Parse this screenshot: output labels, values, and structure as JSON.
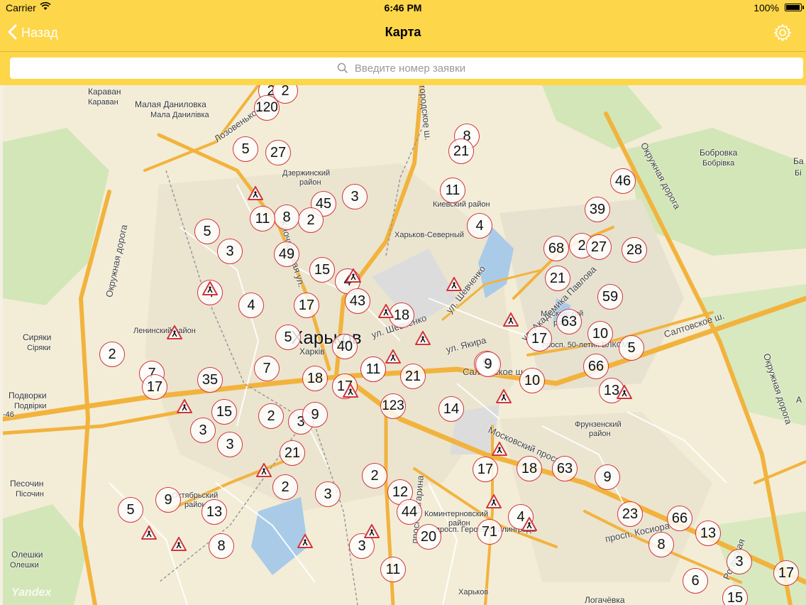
{
  "status_bar": {
    "carrier": "Carrier",
    "time": "6:46 PM",
    "battery": "100%",
    "battery_level": 1.0
  },
  "nav": {
    "back_label": "Назад",
    "title": "Карта"
  },
  "search": {
    "placeholder": "Введите номер заявки",
    "value": ""
  },
  "colors": {
    "bar": "#fdd64a",
    "marker_border": "#d2353c",
    "road": "#f2b33d",
    "park": "#cfe3b3"
  },
  "map": {
    "provider_watermark": "Yandex",
    "labels": {
      "karavan": "Караван",
      "karavan_ua": "Караван",
      "mala_danylivka": "Малая Даниловка",
      "mala_danylivka_ua": "Мала Данилівка",
      "bobrovka": "Бобровка",
      "bobrovka_ua": "Бобрівка",
      "dzerzhinsky": "Дзержинский",
      "dzerzhinsky_2": "район",
      "kievsky": "Киевский район",
      "station_north": "Харьков-Северный",
      "leninsky": "Ленинский район",
      "moskovsky": "Московский",
      "moskovsky_2": "район",
      "siryaky": "Сиряки",
      "siryaky_ua": "Сіряки",
      "kharkov": "Харьков",
      "kharkov_ua": "Харків",
      "podvorki": "Подворки",
      "podvorki_ua": "Подвірки",
      "frunzensky": "Фрунзенский",
      "frunzensky_2": "район",
      "pesochin": "Песочин",
      "pesochin_ua": "Пісочин",
      "oktyabrsky": "Октябрьский",
      "oktyabrsky_2": "район",
      "kominternovsky": "Коминтерновский",
      "kominternovsky_2": "район",
      "oleshki": "Олешки",
      "oleshki_ua": "Олешки",
      "kharkov_bottom": "Харьков",
      "pokatyovka": "Логачёвка",
      "road_okruzh_west": "Окружная дорога",
      "road_okruzh_east": "Окружная дорога",
      "road_okruzh_east2": "Окружная дорога",
      "road_lozovenkovskaya": "Лозовеньковская",
      "road_klochkovskaya": "Клочковская ул.",
      "road_belgorod": "Белгородское ш.",
      "road_shevchenko": "ул. Шевченко",
      "road_shevchenko2": "ул. Шевченко",
      "road_akademika": "ул. Академика Павлова",
      "road_yakira": "ул. Якира",
      "road_50let": "просп. 50-летия ВЛКСМ",
      "road_saltovskoe": "Салтовское ш.",
      "road_saltovskoe2": "Салтовское ш.",
      "road_moskovsky": "Московский просп.",
      "road_gagarina": "просп. Гагарина",
      "road_geroev": "просп. Героев Сталинграда",
      "road_kosiora": "просп. Косиора",
      "road_rogan": "Роганская",
      "m46": "-46",
      "edge_ba": "Ба",
      "edge_bi": "Бі",
      "edge_a": "А"
    },
    "markers": [
      "2",
      "2",
      "120",
      "5",
      "27",
      "8",
      "21",
      "11",
      "3",
      "45",
      "2",
      "8",
      "11",
      "5",
      "3",
      "49",
      "15",
      "4",
      "4",
      "43",
      "17",
      "4",
      "18",
      "11",
      "4",
      "46",
      "39",
      "68",
      "2",
      "27",
      "28",
      "21",
      "59",
      "63",
      "10",
      "17",
      "9",
      "10",
      "66",
      "13",
      "5",
      "2",
      "7",
      "17",
      "35",
      "7",
      "5",
      "40",
      "18",
      "17",
      "11",
      "21",
      "123",
      "14",
      "9",
      "15",
      "2",
      "3",
      "9",
      "3",
      "3",
      "21",
      "2",
      "3",
      "17",
      "18",
      "63",
      "9",
      "12",
      "44",
      "2",
      "9",
      "5",
      "13",
      "4",
      "71",
      "23",
      "66",
      "13",
      "8",
      "20",
      "3",
      "11",
      "8",
      "6",
      "3",
      "17",
      "15"
    ]
  }
}
